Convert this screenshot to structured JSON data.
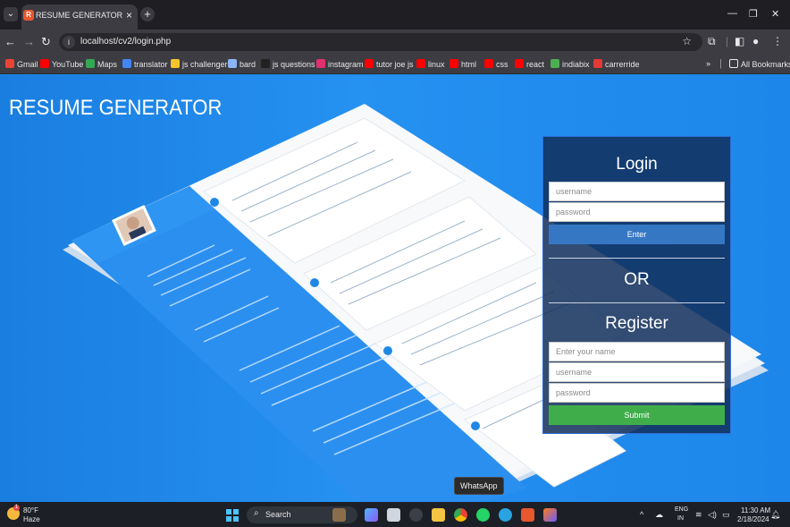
{
  "browser": {
    "tab_title": "RESUME GENERATOR",
    "url": "localhost/cv2/login.php",
    "bookmarks": [
      {
        "label": "Gmail",
        "color": "#ea4335"
      },
      {
        "label": "YouTube",
        "color": "#ff0000"
      },
      {
        "label": "Maps",
        "color": "#34a853"
      },
      {
        "label": "translator",
        "color": "#4285f4"
      },
      {
        "label": "js challenger",
        "color": "#f7c52b"
      },
      {
        "label": "bard",
        "color": "#8ab4f8"
      },
      {
        "label": "js questions",
        "color": "#222222"
      },
      {
        "label": "instagram",
        "color": "#e1306c"
      },
      {
        "label": "tutor joe js",
        "color": "#ff0000"
      },
      {
        "label": "linux",
        "color": "#ff0000"
      },
      {
        "label": "html",
        "color": "#ff0000"
      },
      {
        "label": "css",
        "color": "#ff0000"
      },
      {
        "label": "react",
        "color": "#ff0000"
      },
      {
        "label": "indiabix",
        "color": "#4caf50"
      },
      {
        "label": "carrerride",
        "color": "#e53935"
      }
    ],
    "all_bookmarks": "All Bookmarks"
  },
  "page": {
    "title": "RESUME GENERATOR",
    "login": {
      "heading": "Login",
      "username_placeholder": "username",
      "password_placeholder": "password",
      "enter_label": "Enter"
    },
    "or_text": "OR",
    "register": {
      "heading": "Register",
      "name_placeholder": "Enter your name",
      "username_placeholder": "username",
      "password_placeholder": "password",
      "submit_label": "Submit"
    }
  },
  "tooltip": "WhatsApp",
  "taskbar": {
    "temperature": "80°F",
    "condition": "Haze",
    "search_label": "Search",
    "lang_line1": "ENG",
    "lang_line2": "IN",
    "time": "11:30 AM",
    "date": "2/18/2024"
  },
  "colors": {
    "page_bg": "#1e88e5",
    "panel_bg": "#12305c",
    "enter_button": "#3677c4",
    "submit_button": "#3fae4a"
  }
}
